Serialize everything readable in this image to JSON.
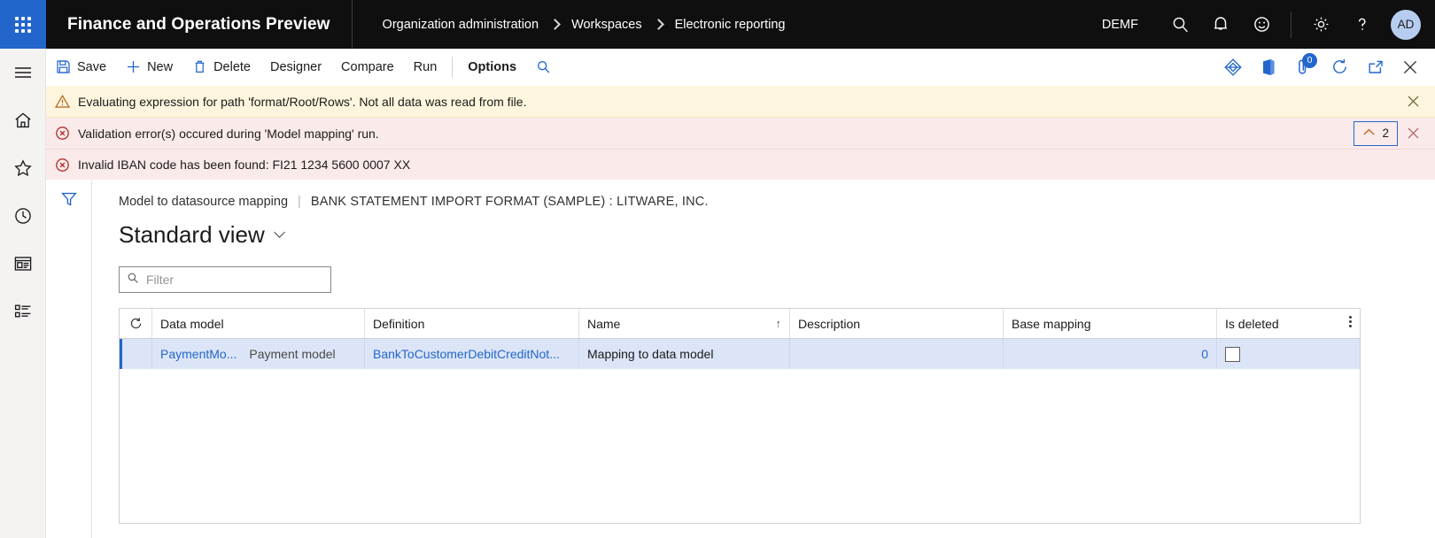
{
  "topbar": {
    "waffle_label": "app-launcher",
    "app_title": "Finance and Operations Preview",
    "breadcrumb": [
      "Organization administration",
      "Workspaces",
      "Electronic reporting"
    ],
    "company_code": "DEMF",
    "icons": [
      "search-icon",
      "notifications-bell-icon",
      "feedback-smiley-icon",
      "settings-gear-icon",
      "help-question-icon"
    ],
    "avatar_initials": "AD"
  },
  "rail": {
    "items": [
      {
        "name": "hamburger-menu-icon",
        "label": "Expand the navigation pane"
      },
      {
        "name": "home-icon",
        "label": "Home"
      },
      {
        "name": "star-favorites-icon",
        "label": "Favorites"
      },
      {
        "name": "clock-recent-icon",
        "label": "Recent"
      },
      {
        "name": "workspaces-icon",
        "label": "Workspaces"
      },
      {
        "name": "modules-list-icon",
        "label": "Modules"
      }
    ]
  },
  "toolbar": {
    "save_label": "Save",
    "new_label": "New",
    "delete_label": "Delete",
    "designer_label": "Designer",
    "compare_label": "Compare",
    "run_label": "Run",
    "options_label": "Options",
    "search_label": "search-icon",
    "right_icons": [
      {
        "name": "diamond-attachments-icon"
      },
      {
        "name": "office-app-icon"
      },
      {
        "name": "attachments-icon",
        "badge": "0"
      },
      {
        "name": "refresh-circle-icon"
      },
      {
        "name": "open-in-new-window-icon"
      },
      {
        "name": "close-icon"
      }
    ]
  },
  "messages": {
    "warning": {
      "icon": "warning-triangle-icon",
      "text": "Evaluating expression for path 'format/Root/Rows'.   Not all data was read from file.",
      "close": "close-icon"
    },
    "error_header": {
      "icon": "error-circle-icon",
      "text": "Validation error(s) occured during 'Model mapping' run.",
      "collapse_icon": "chevron-up-icon",
      "collapse_count": "2",
      "close": "close-icon"
    },
    "error_detail": {
      "icon": "error-circle-icon",
      "text": "Invalid IBAN code has been found: FI21 1234 5600 0007 XX"
    }
  },
  "content": {
    "filter_pane_icon": "funnel-filter-icon",
    "caption_primary": "Model to datasource mapping",
    "caption_separator": "|",
    "caption_secondary": "BANK STATEMENT IMPORT FORMAT (SAMPLE) : LITWARE, INC.",
    "view_title": "Standard view",
    "filter_placeholder": "Filter",
    "filter_value": "",
    "filter_icon": "search-icon"
  },
  "grid": {
    "refresh_icon": "refresh-icon",
    "overflow_icon": "more-options-icon",
    "columns": [
      {
        "key": "data_model",
        "label": "Data model",
        "sorted": false
      },
      {
        "key": "definition",
        "label": "Definition",
        "sorted": false
      },
      {
        "key": "name",
        "label": "Name",
        "sorted": true,
        "sort_arrow": "↑"
      },
      {
        "key": "description",
        "label": "Description",
        "sorted": false
      },
      {
        "key": "base_mapping",
        "label": "Base mapping",
        "sorted": false
      },
      {
        "key": "is_deleted",
        "label": "Is deleted",
        "sorted": false
      }
    ],
    "rows": [
      {
        "selected": true,
        "data_model_link": "PaymentMo...",
        "data_model_text": "Payment model",
        "definition": "BankToCustomerDebitCreditNot...",
        "name": "Mapping to data model",
        "description": "",
        "base_mapping": "0",
        "is_deleted": false
      }
    ]
  },
  "colors": {
    "brand_blue": "#2266cc",
    "header_black": "#0f0f0f",
    "warning_bg": "#fdf5dd",
    "error_bg": "#fbeaea",
    "row_selected_bg": "#dce5f7"
  }
}
